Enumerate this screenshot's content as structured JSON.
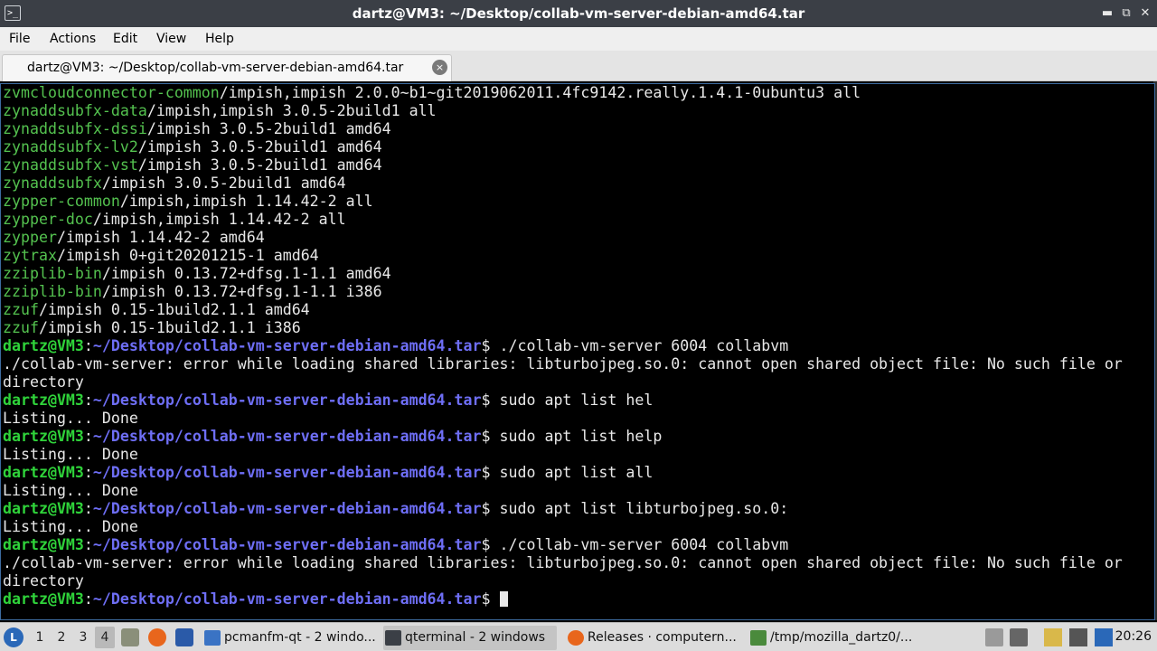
{
  "window": {
    "title": "dartz@VM3: ~/Desktop/collab-vm-server-debian-amd64.tar",
    "app_icon_glyph": ">_",
    "minimize_glyph": "▬",
    "restore_glyph": "⧉",
    "close_glyph": "✕"
  },
  "menubar": {
    "items": [
      "File",
      "Actions",
      "Edit",
      "View",
      "Help"
    ]
  },
  "tab": {
    "label": "dartz@VM3: ~/Desktop/collab-vm-server-debian-amd64.tar",
    "close_glyph": "×"
  },
  "terminal": {
    "prompt_user": "dartz@VM3",
    "prompt_path": "~/Desktop/collab-vm-server-debian-amd64.tar",
    "packages": [
      {
        "name": "zvmcloudconnector-common",
        "rest": "/impish,impish 2.0.0~b1~git2019062011.4fc9142.really.1.4.1-0ubuntu3 all"
      },
      {
        "name": "zynaddsubfx-data",
        "rest": "/impish,impish 3.0.5-2build1 all"
      },
      {
        "name": "zynaddsubfx-dssi",
        "rest": "/impish 3.0.5-2build1 amd64"
      },
      {
        "name": "zynaddsubfx-lv2",
        "rest": "/impish 3.0.5-2build1 amd64"
      },
      {
        "name": "zynaddsubfx-vst",
        "rest": "/impish 3.0.5-2build1 amd64"
      },
      {
        "name": "zynaddsubfx",
        "rest": "/impish 3.0.5-2build1 amd64"
      },
      {
        "name": "zypper-common",
        "rest": "/impish,impish 1.14.42-2 all"
      },
      {
        "name": "zypper-doc",
        "rest": "/impish,impish 1.14.42-2 all"
      },
      {
        "name": "zypper",
        "rest": "/impish 1.14.42-2 amd64"
      },
      {
        "name": "zytrax",
        "rest": "/impish 0+git20201215-1 amd64"
      },
      {
        "name": "zziplib-bin",
        "rest": "/impish 0.13.72+dfsg.1-1.1 amd64"
      },
      {
        "name": "zziplib-bin",
        "rest": "/impish 0.13.72+dfsg.1-1.1 i386"
      },
      {
        "name": "zzuf",
        "rest": "/impish 0.15-1build2.1.1 amd64"
      },
      {
        "name": "zzuf",
        "rest": "/impish 0.15-1build2.1.1 i386"
      }
    ],
    "session": [
      {
        "type": "prompt",
        "cmd": "$ ./collab-vm-server 6004 collabvm"
      },
      {
        "type": "output",
        "text": "./collab-vm-server: error while loading shared libraries: libturbojpeg.so.0: cannot open shared object file: No such file or"
      },
      {
        "type": "output",
        "text": "directory"
      },
      {
        "type": "prompt",
        "cmd": "$ sudo apt list hel"
      },
      {
        "type": "output",
        "text": "Listing... Done"
      },
      {
        "type": "prompt",
        "cmd": "$ sudo apt list help"
      },
      {
        "type": "output",
        "text": "Listing... Done"
      },
      {
        "type": "prompt",
        "cmd": "$ sudo apt list all"
      },
      {
        "type": "output",
        "text": "Listing... Done"
      },
      {
        "type": "prompt",
        "cmd": "$ sudo apt list libturbojpeg.so.0:"
      },
      {
        "type": "output",
        "text": "Listing... Done"
      },
      {
        "type": "prompt",
        "cmd": "$ ./collab-vm-server 6004 collabvm"
      },
      {
        "type": "output",
        "text": "./collab-vm-server: error while loading shared libraries: libturbojpeg.so.0: cannot open shared object file: No such file or"
      },
      {
        "type": "output",
        "text": "directory"
      },
      {
        "type": "prompt",
        "cmd": "$ ",
        "cursor": true
      }
    ],
    "colors": {
      "background": "#000000",
      "package_name": "#54c24f",
      "prompt_user": "#2fd33a",
      "prompt_path": "#6e6ef5",
      "text": "#e8e8e8"
    }
  },
  "taskbar": {
    "start_glyph": "L",
    "workspaces": [
      "1",
      "2",
      "3",
      "4"
    ],
    "active_workspace": "4",
    "tasks": [
      {
        "label": "pcmanfm-qt - 2 windo...",
        "icon": "folder-icon",
        "active": false
      },
      {
        "label": "qterminal - 2 windows",
        "icon": "terminal-icon",
        "active": true
      },
      {
        "label": "Releases · computern...",
        "icon": "firefox-icon",
        "active": false
      },
      {
        "label": "/tmp/mozilla_dartz0/...",
        "icon": "text-editor-icon",
        "active": false
      }
    ],
    "clock": "20:26"
  }
}
